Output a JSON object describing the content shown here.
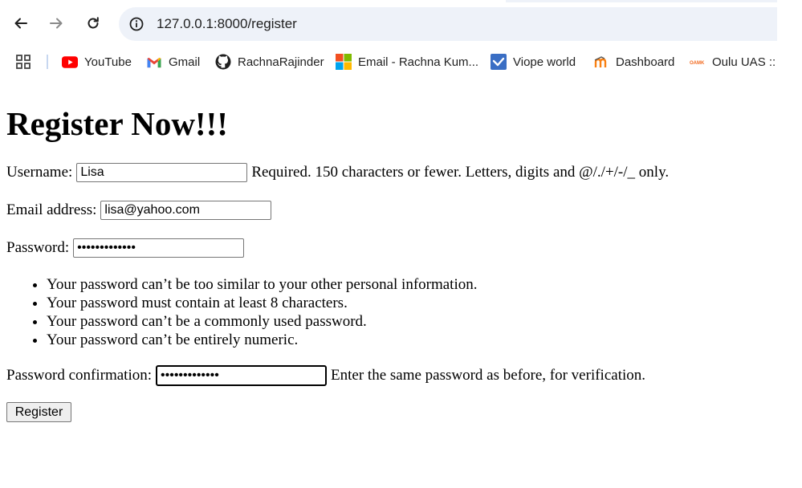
{
  "browser": {
    "url": "127.0.0.1:8000/register",
    "bookmarks": [
      {
        "label": "YouTube",
        "icon": "youtube-icon"
      },
      {
        "label": "Gmail",
        "icon": "gmail-icon"
      },
      {
        "label": "RachnaRajinder",
        "icon": "github-icon"
      },
      {
        "label": "Email - Rachna Kum...",
        "icon": "outlook-icon"
      },
      {
        "label": "Viope world",
        "icon": "viope-icon"
      },
      {
        "label": "Dashboard",
        "icon": "moodle-icon"
      },
      {
        "label": "Oulu UAS :: S",
        "icon": "oamk-icon"
      }
    ]
  },
  "page": {
    "title": "Register Now!!!",
    "username": {
      "label": "Username:",
      "value": "Lisa",
      "help": "Required. 150 characters or fewer. Letters, digits and @/./+/-/_ only."
    },
    "email": {
      "label": "Email address:",
      "value": "lisa@yahoo.com"
    },
    "password": {
      "label": "Password:",
      "value": "•••••••••••••"
    },
    "password_rules": [
      "Your password can’t be too similar to your other personal information.",
      "Your password must contain at least 8 characters.",
      "Your password can’t be a commonly used password.",
      "Your password can’t be entirely numeric."
    ],
    "password_confirmation": {
      "label": "Password confirmation:",
      "value": "•••••••••••••",
      "help": "Enter the same password as before, for verification."
    },
    "submit_label": "Register"
  },
  "colors": {
    "omnibox_bg": "#eef2f9",
    "youtube_red": "#ff0000",
    "separator": "#c7d7f0"
  }
}
